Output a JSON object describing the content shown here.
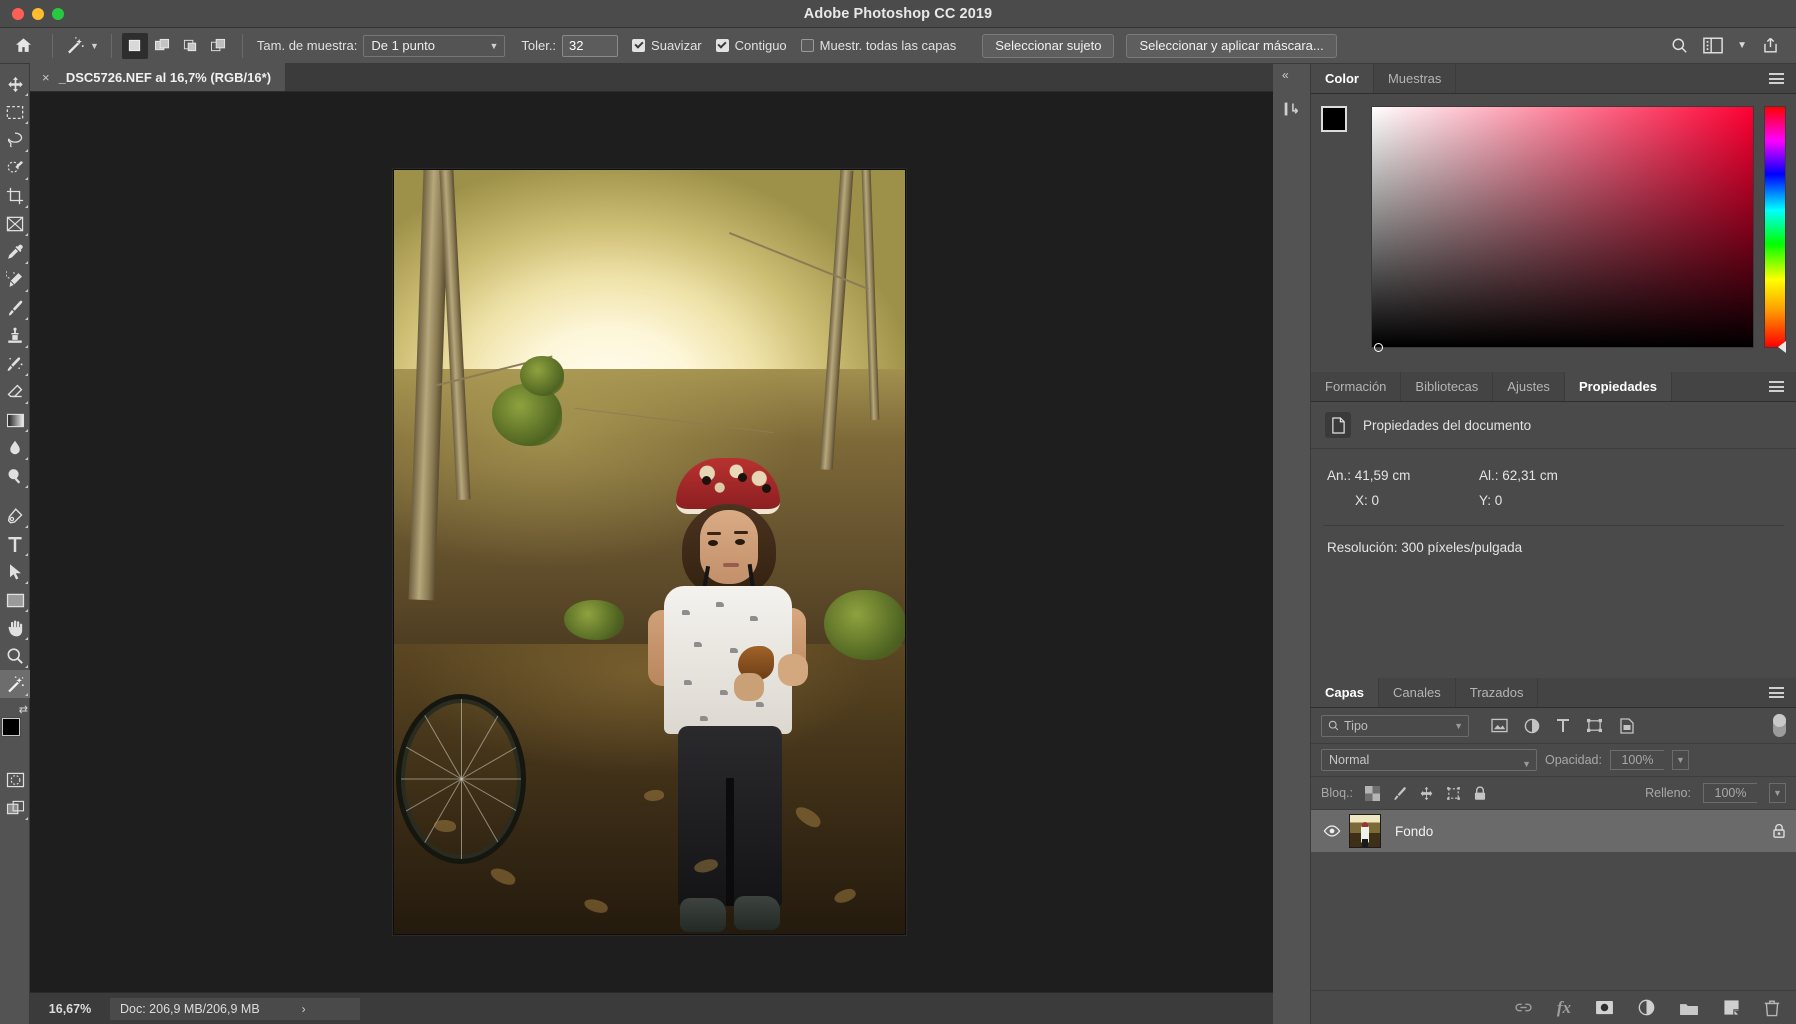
{
  "window": {
    "title": "Adobe Photoshop CC 2019",
    "traffic_lights": [
      "close",
      "minimize",
      "maximize"
    ]
  },
  "options_bar": {
    "home_icon": "home-icon",
    "active_tool_icon": "magic-wand-icon",
    "tool_preset_chevron": "chevron-down-icon",
    "selection_modes": [
      {
        "name": "new-selection",
        "active": true
      },
      {
        "name": "add-to-selection",
        "active": false
      },
      {
        "name": "subtract-from-selection",
        "active": false
      },
      {
        "name": "intersect-with-selection",
        "active": false
      }
    ],
    "sample_size_label": "Tam. de muestra:",
    "sample_size_value": "De 1 punto",
    "tolerance_label": "Toler.:",
    "tolerance_value": "32",
    "antialias_label": "Suavizar",
    "antialias_checked": true,
    "contiguous_label": "Contiguo",
    "contiguous_checked": true,
    "all_layers_label": "Muestr. todas las capas",
    "all_layers_checked": false,
    "select_subject_label": "Seleccionar sujeto",
    "select_and_mask_label": "Seleccionar y aplicar máscara...",
    "right_icons": [
      "search-icon",
      "workspace-icon",
      "chevron-down-icon",
      "share-icon"
    ]
  },
  "toolbar": {
    "tools": [
      {
        "name": "move-tool",
        "selected": false
      },
      {
        "name": "rectangular-marquee-tool",
        "selected": false
      },
      {
        "name": "lasso-tool",
        "selected": false
      },
      {
        "name": "quick-selection-tool",
        "selected": false
      },
      {
        "name": "crop-tool",
        "selected": false
      },
      {
        "name": "frame-tool",
        "selected": false
      },
      {
        "name": "eyedropper-tool",
        "selected": false
      },
      {
        "name": "spot-healing-brush-tool",
        "selected": false
      },
      {
        "name": "brush-tool",
        "selected": false
      },
      {
        "name": "clone-stamp-tool",
        "selected": false
      },
      {
        "name": "history-brush-tool",
        "selected": false
      },
      {
        "name": "eraser-tool",
        "selected": false
      },
      {
        "name": "gradient-tool",
        "selected": false
      },
      {
        "name": "blur-tool",
        "selected": false
      },
      {
        "name": "dodge-tool",
        "selected": false
      },
      {
        "name": "pen-tool",
        "selected": false
      },
      {
        "name": "type-tool",
        "selected": false
      },
      {
        "name": "path-selection-tool",
        "selected": false
      },
      {
        "name": "rectangle-tool",
        "selected": false
      },
      {
        "name": "hand-tool",
        "selected": false
      },
      {
        "name": "zoom-tool",
        "selected": false
      },
      {
        "name": "magic-wand-tool",
        "selected": true
      }
    ],
    "foreground_color": "#000000",
    "background_color": "#ffffff",
    "quick_mask_icon": "quick-mask-icon",
    "screen_mode_icon": "screen-mode-icon"
  },
  "document": {
    "tab_label": "_DSC5726.NEF al 16,7% (RGB/16*)",
    "close_glyph": "×"
  },
  "status_bar": {
    "zoom": "16,67%",
    "doc_info": "Doc: 206,9 MB/206,9 MB",
    "expand_glyph": "›"
  },
  "dock": {
    "collapse_glyph": "«",
    "expand_glyph": "»",
    "rail_icon": "history-log-icon"
  },
  "color_panel": {
    "tabs": [
      {
        "label": "Color",
        "active": true
      },
      {
        "label": "Muestras",
        "active": false
      }
    ],
    "menu_icon": "panel-menu-icon",
    "foreground": "#000000",
    "background": "#ffffff",
    "field_gradient_from": "#ffffff",
    "field_gradient_to": "#ff0033"
  },
  "properties_panel": {
    "tabs": [
      {
        "label": "Formación",
        "active": false
      },
      {
        "label": "Bibliotecas",
        "active": false
      },
      {
        "label": "Ajustes",
        "active": false
      },
      {
        "label": "Propiedades",
        "active": true
      }
    ],
    "menu_icon": "panel-menu-icon",
    "header_icon": "document-icon",
    "header_title": "Propiedades del documento",
    "width_label": "An.:",
    "width_value": "41,59 cm",
    "height_label": "Al.:",
    "height_value": "62,31 cm",
    "x_label": "X:",
    "x_value": "0",
    "y_label": "Y:",
    "y_value": "0",
    "resolution_text": "Resolución: 300 píxeles/pulgada"
  },
  "layers_panel": {
    "tabs": [
      {
        "label": "Capas",
        "active": true
      },
      {
        "label": "Canales",
        "active": false
      },
      {
        "label": "Trazados",
        "active": false
      }
    ],
    "menu_icon": "panel-menu-icon",
    "filter_placeholder": "Tipo",
    "filter_icon": "search-icon",
    "filter_type_icons": [
      "image-filter-icon",
      "adjustment-filter-icon",
      "type-filter-icon",
      "shape-filter-icon",
      "smart-object-filter-icon"
    ],
    "filter_toggle_icon": "filter-toggle-switch",
    "blend_mode": "Normal",
    "opacity_label": "Opacidad:",
    "opacity_value": "100%",
    "lock_label": "Bloq.:",
    "lock_icons": [
      "lock-transparent-pixels-icon",
      "lock-image-pixels-icon",
      "lock-position-icon",
      "lock-artboard-icon",
      "lock-all-icon"
    ],
    "fill_label": "Relleno:",
    "fill_value": "100%",
    "layers": [
      {
        "name": "Fondo",
        "visible": true,
        "locked": true,
        "selected": true,
        "visibility_icon": "eye-icon",
        "lock_icon": "lock-icon"
      }
    ],
    "footer_icons": [
      "link-layers-icon",
      "layer-fx-icon",
      "add-layer-mask-icon",
      "new-adjustment-layer-icon",
      "new-group-icon",
      "new-layer-icon",
      "delete-layer-icon"
    ],
    "footer_fx_label": "fx"
  },
  "canvas": {
    "zoom_percent": "16,67%",
    "image_description": "child-in-forest-photo"
  }
}
